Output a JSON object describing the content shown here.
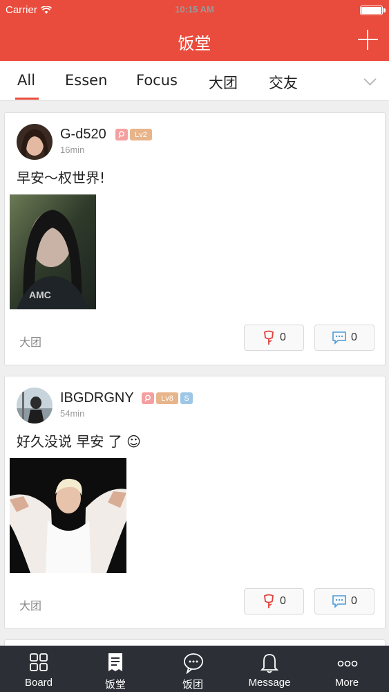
{
  "status_bar": {
    "carrier": "Carrier",
    "time": "10:15 AM"
  },
  "header": {
    "title": "饭堂"
  },
  "tabs": [
    {
      "label": "All"
    },
    {
      "label": "Essen"
    },
    {
      "label": "Focus"
    },
    {
      "label": "大团"
    },
    {
      "label": "交友"
    }
  ],
  "posts": [
    {
      "username": "G-d520",
      "level": "Lv2",
      "time": "16min",
      "text": "早安～权世界!",
      "group": "大团",
      "likes": "0",
      "comments": "0"
    },
    {
      "username": "IBGDRGNY",
      "level": "Lv8",
      "extra_badge": "S",
      "time": "54min",
      "text": "好久没说 早安 了 ☺",
      "group": "大团",
      "likes": "0",
      "comments": "0"
    }
  ],
  "bottom_nav": [
    {
      "label": "Board"
    },
    {
      "label": "饭堂"
    },
    {
      "label": "饭团"
    },
    {
      "label": "Message"
    },
    {
      "label": "More"
    }
  ],
  "colors": {
    "accent": "#e94b3c",
    "bottom_bar": "#2c3036"
  }
}
